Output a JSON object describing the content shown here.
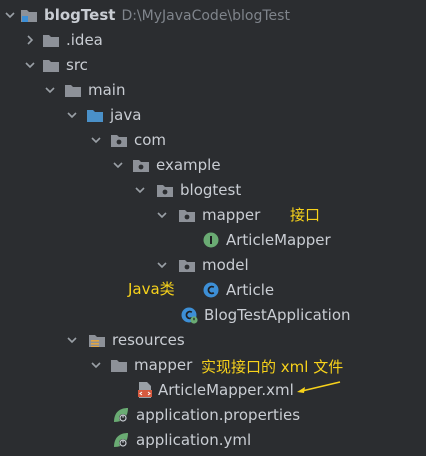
{
  "tree": {
    "project": {
      "name": "blogTest",
      "path": "D:\\MyJavaCode\\blogTest"
    },
    "idea": ".idea",
    "src": "src",
    "main": "main",
    "java": "java",
    "com": "com",
    "example": "example",
    "blogtest": "blogtest",
    "mapper_pkg": "mapper",
    "article_mapper_iface": "ArticleMapper",
    "model": "model",
    "article_class": "Article",
    "app_class": "BlogTestApplication",
    "resources": "resources",
    "mapper_dir": "mapper",
    "mapper_xml": "ArticleMapper.xml",
    "app_properties": "application.properties",
    "app_yml": "application.yml"
  },
  "annotations": {
    "interface": "接口",
    "java_class": "Java类",
    "xml_impl": "实现接口的 xml 文件"
  },
  "colors": {
    "background": "#2b2d30",
    "annotation": "#f7d21b",
    "folder": "#8d9198",
    "source_folder": "#4a90c8",
    "interface_icon": "#6aab73",
    "class_icon": "#3d8fd6"
  }
}
